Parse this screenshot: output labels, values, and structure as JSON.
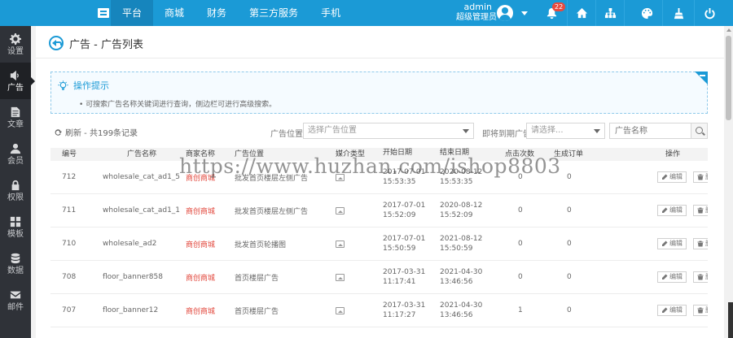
{
  "topnav": {
    "items": [
      {
        "label": "平台",
        "active": true
      },
      {
        "label": "商城",
        "active": false
      },
      {
        "label": "财务",
        "active": false
      },
      {
        "label": "第三方服务",
        "active": false
      },
      {
        "label": "手机",
        "active": false
      }
    ],
    "user": {
      "name": "admin",
      "role": "超级管理员"
    },
    "notification_count": "22",
    "icons": [
      "bell-icon",
      "home-icon",
      "sitemap-icon",
      "palette-icon",
      "broom-icon",
      "power-icon"
    ]
  },
  "sidebar": {
    "items": [
      {
        "label": "设置",
        "icon": "gear-icon"
      },
      {
        "label": "广告",
        "icon": "volume-icon",
        "active": true
      },
      {
        "label": "文章",
        "icon": "document-icon"
      },
      {
        "label": "会员",
        "icon": "user-icon"
      },
      {
        "label": "权限",
        "icon": "lock-icon"
      },
      {
        "label": "模板",
        "icon": "grid-icon"
      },
      {
        "label": "数据",
        "icon": "database-icon"
      },
      {
        "label": "邮件",
        "icon": "mail-icon"
      }
    ]
  },
  "page": {
    "title": "广告 - 广告列表"
  },
  "tips": {
    "title": "操作提示",
    "text": "• 可搜索广告名称关键词进行查询，侧边栏可进行高级搜索。"
  },
  "toolbar": {
    "refresh_label": "刷新 - 共199条记录",
    "position_label": "广告位置：",
    "position_placeholder": "选择广告位置",
    "expiring_label": "即将到期广告：",
    "expiring_placeholder": "请选择...",
    "search_placeholder": "广告名称"
  },
  "table": {
    "headers": [
      "编号",
      "广告名称",
      "商家名称",
      "广告位置",
      "媒介类型",
      "开始日期",
      "结束日期",
      "点击次数",
      "生成订单",
      "操作"
    ],
    "edit_label": "编辑",
    "delete_label": "删除",
    "rows": [
      {
        "id": "712",
        "name": "wholesale_cat_ad1_5",
        "merchant": "商创商城",
        "position": "批发首页楼层左侧广告",
        "start_date": "2017-07-01",
        "start_time": "15:53:35",
        "end_date": "2020-08-12",
        "end_time": "15:53:35",
        "clicks": "0",
        "orders": "0"
      },
      {
        "id": "711",
        "name": "wholesale_cat_ad1_1",
        "merchant": "商创商城",
        "position": "批发首页楼层左侧广告",
        "start_date": "2017-07-01",
        "start_time": "15:52:09",
        "end_date": "2020-08-12",
        "end_time": "15:52:09",
        "clicks": "0",
        "orders": "0"
      },
      {
        "id": "710",
        "name": "wholesale_ad2",
        "merchant": "商创商城",
        "position": "批发首页轮播图",
        "start_date": "2017-07-01",
        "start_time": "15:50:59",
        "end_date": "2021-08-12",
        "end_time": "15:50:59",
        "clicks": "0",
        "orders": "0"
      },
      {
        "id": "708",
        "name": "floor_banner858",
        "merchant": "商创商城",
        "position": "首页楼层广告",
        "start_date": "2017-03-31",
        "start_time": "11:17:41",
        "end_date": "2021-04-30",
        "end_time": "13:46:56",
        "clicks": "0",
        "orders": "0"
      },
      {
        "id": "707",
        "name": "floor_banner12",
        "merchant": "商创商城",
        "position": "首页楼层广告",
        "start_date": "2017-03-31",
        "start_time": "11:17:27",
        "end_date": "2021-04-30",
        "end_time": "13:46:56",
        "clicks": "1",
        "orders": "0"
      }
    ]
  },
  "watermark": "https://www.huzhan.com/ishop8803",
  "colors": {
    "topbar": "#1b9ad6",
    "sidebar": "#2f3238",
    "merchant": "#e2463b",
    "badge": "#e84a3f"
  }
}
